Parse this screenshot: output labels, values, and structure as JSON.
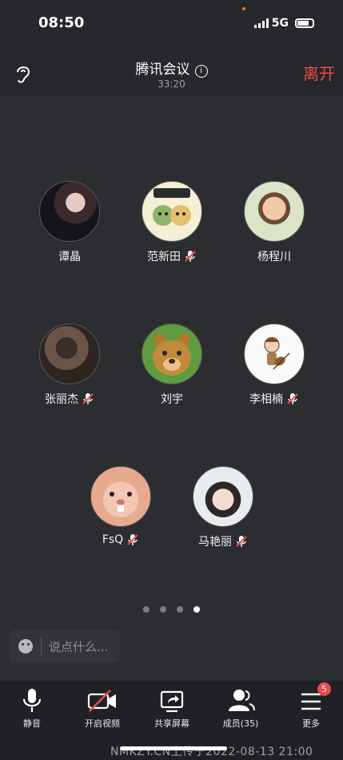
{
  "status": {
    "time": "08:50",
    "network": "5G"
  },
  "header": {
    "title": "腾讯会议",
    "duration": "33:20",
    "leave_label": "离开"
  },
  "participants": [
    {
      "name": "谭晶",
      "muted": false
    },
    {
      "name": "范新田",
      "muted": true
    },
    {
      "name": "杨程川",
      "muted": false
    },
    {
      "name": "张丽杰",
      "muted": true
    },
    {
      "name": "刘宇",
      "muted": false
    },
    {
      "name": "李相楠",
      "muted": true
    },
    {
      "name": "FsQ",
      "muted": true
    },
    {
      "name": "马艳丽",
      "muted": true
    }
  ],
  "pagination": {
    "pages": 4,
    "current": 4
  },
  "chat": {
    "placeholder": "说点什么..."
  },
  "toolbar": {
    "mute_label": "静音",
    "video_label": "开启视频",
    "share_label": "共享屏幕",
    "members_label": "成员(35)",
    "more_label": "更多",
    "more_badge": "5"
  },
  "watermark": "NMKZY.CN上传于2022-08-13 21:00",
  "colors": {
    "accent_red": "#ec4b4b",
    "background": "#2b2d31",
    "toolbar": "#1f2124"
  }
}
